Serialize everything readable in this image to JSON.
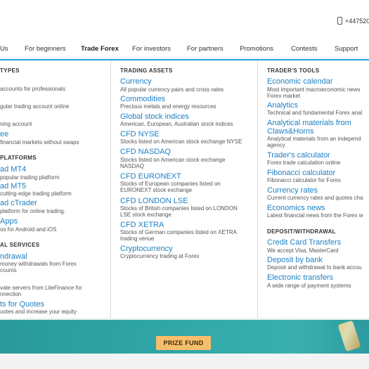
{
  "header": {
    "phone": "+447520"
  },
  "nav": {
    "items": [
      {
        "label": "Us"
      },
      {
        "label": "For beginners"
      },
      {
        "label": "Trade Forex"
      },
      {
        "label": "For investors"
      },
      {
        "label": "For partners"
      },
      {
        "label": "Promotions"
      },
      {
        "label": "Contests"
      },
      {
        "label": "Support"
      }
    ]
  },
  "col1": {
    "account_types_title": "TYPES",
    "account_types": [
      {
        "desc": "accounts for professionals"
      },
      {
        "desc": "gular trading account online"
      },
      {
        "desc": "ning account"
      },
      {
        "label": "ee",
        "desc": "financial markets without swaps"
      }
    ],
    "platforms_title": "PLATFORMS",
    "platforms": [
      {
        "label": "ad MT4",
        "desc": "popular trading platform"
      },
      {
        "label": "ad MT5",
        "desc": "cutting-edge trading platform"
      },
      {
        "label": "ad cTrader",
        "desc": "platform for online trading."
      },
      {
        "label": "Apps",
        "desc": "os for Android and iOS"
      }
    ],
    "services_title": "AL SERVICES",
    "services": [
      {
        "label": "ndrawal",
        "desc1": "money withdrawals from Forex",
        "desc2": "counts"
      },
      {
        "desc1": "vate servers from LiteFinance for",
        "desc2": "nnection"
      },
      {
        "label": "ts for Quotes",
        "desc1": "uotes and increase your equity"
      }
    ]
  },
  "col2": {
    "title": "TRADING ASSETS",
    "items": [
      {
        "label": "Currency",
        "desc1": "All popular currency pairs and cross rates"
      },
      {
        "label": "Commodities",
        "desc1": "Precious metals and energy resources"
      },
      {
        "label": "Global stock indices",
        "desc1": "American, European, Australian stock indices"
      },
      {
        "label": "CFD NYSE",
        "desc1": "Stocks listed on American stock exchange NYSE"
      },
      {
        "label": "CFD NASDAQ",
        "desc1": "Stocks listed on American stock exchange",
        "desc2": "NASDAQ"
      },
      {
        "label": "CFD EURONEXT",
        "desc1": "Stocks of European companies listed on",
        "desc2": "EURONEXT stock exchange"
      },
      {
        "label": "CFD LONDON LSE",
        "desc1": "Stocks of British companies listed on LONDON",
        "desc2": "LSE stock exchange"
      },
      {
        "label": "CFD XETRA",
        "desc1": "Stocks of German companies listed on XETRA",
        "desc2": "trading venue"
      },
      {
        "label": "Cryptocurrency",
        "desc1": "Cryptocurrency trading at Forex"
      }
    ]
  },
  "col3": {
    "tools_title": "TRADER'S TOOLS",
    "tools": [
      {
        "label": "Economic calendar",
        "desc1": "Most important macroeconomic news",
        "desc2": "Forex market"
      },
      {
        "label": "Analytics",
        "desc1": "Technical and fundamental Forex anal"
      },
      {
        "label": "Analytical materials from",
        "label2": "Claws&Horns",
        "desc1": "Analytical materials from an independ",
        "desc2": "agency"
      },
      {
        "label": "Trader's calculator",
        "desc1": "Forex trade calculation online"
      },
      {
        "label": "Fibonacci calculator",
        "desc1": "Fibonacci calculator for Forex"
      },
      {
        "label": "Currency rates",
        "desc1": "Current currency rates and quotes cha"
      },
      {
        "label": "Economics news",
        "desc1": "Latest financial news from the Forex w"
      }
    ],
    "deposit_title": "DEPOSIT/WITHDRAWAL",
    "deposit": [
      {
        "label": "Credit Card Transfers",
        "desc1": "We accept Visa, MasterCard"
      },
      {
        "label": "Deposit by bank",
        "desc1": "Deposit and withdrawal to bank accou"
      },
      {
        "label": "Electronic transfers",
        "desc1": "A wide range of payment systems"
      }
    ]
  },
  "banner": {
    "button_label": "PRIZE FUND"
  }
}
